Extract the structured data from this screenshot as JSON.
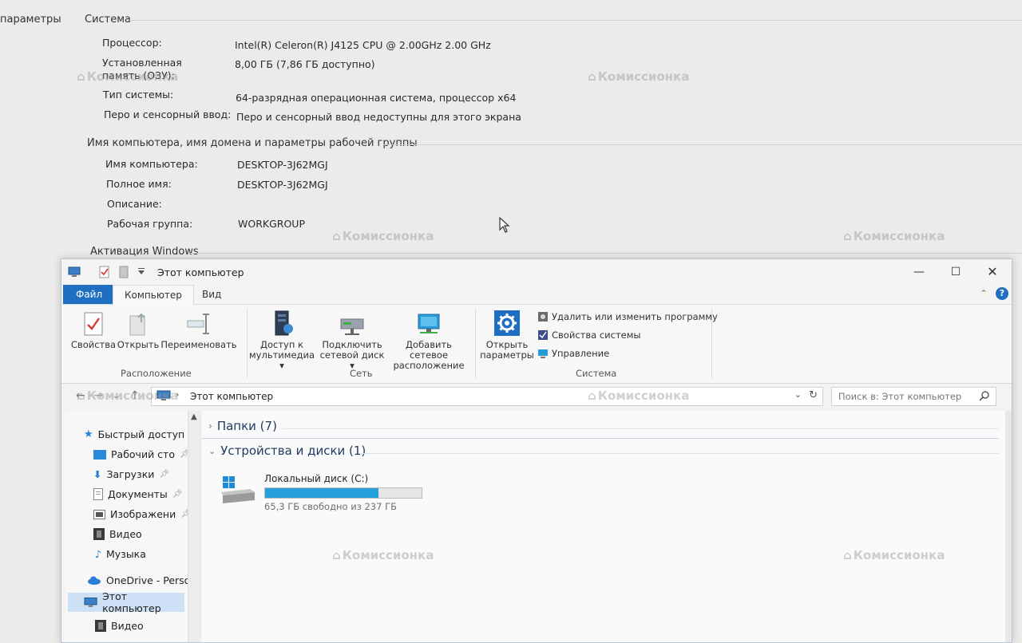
{
  "system_page": {
    "left_nav_label": "параметры",
    "section_system": "Система",
    "system_props": [
      {
        "label": "Процессор:",
        "value": "Intel(R) Celeron(R) J4125 CPU @ 2.00GHz   2.00 GHz"
      },
      {
        "label": "Установленная память (ОЗУ):",
        "value": "8,00 ГБ (7,86 ГБ доступно)"
      },
      {
        "label": "Тип системы:",
        "value": "64-разрядная операционная система, процессор x64"
      },
      {
        "label": "Перо и сенсорный ввод:",
        "value": "Перо и сенсорный ввод недоступны для этого экрана"
      }
    ],
    "section_computer": "Имя компьютера, имя домена и параметры рабочей группы",
    "computer_props": [
      {
        "label": "Имя компьютера:",
        "value": "DESKTOP-3J62MGJ"
      },
      {
        "label": "Полное имя:",
        "value": "DESKTOP-3J62MGJ"
      },
      {
        "label": "Описание:",
        "value": ""
      },
      {
        "label": "Рабочая группа:",
        "value": "WORKGROUP"
      }
    ],
    "section_activation": "Активация Windows"
  },
  "watermark_text": "Комиссионка",
  "explorer": {
    "title": "Этот компьютер",
    "window_buttons": {
      "minimize": "—",
      "maximize": "☐",
      "close": "✕"
    },
    "tabs": {
      "file": "Файл",
      "computer": "Компьютер",
      "view": "Вид"
    },
    "help": "?",
    "ribbon": {
      "properties": "Свойства",
      "open": "Открыть",
      "rename": "Переименовать",
      "group_location": "Расположение",
      "media_access_1": "Доступ к",
      "media_access_2": "мультимедиа ▾",
      "map_drive_1": "Подключить",
      "map_drive_2": "сетевой диск ▾",
      "add_location_1": "Добавить сетевое",
      "add_location_2": "расположение",
      "group_network": "Сеть",
      "open_settings_1": "Открыть",
      "open_settings_2": "параметры",
      "uninstall": "Удалить или изменить программу",
      "system_properties": "Свойства системы",
      "manage": "Управление",
      "group_system": "Система"
    },
    "address": {
      "path": "Этот компьютер",
      "search_placeholder": "Поиск в: Этот компьютер"
    },
    "nav": {
      "quick_access": "Быстрый доступ",
      "desktop": "Рабочий сто",
      "downloads": "Загрузки",
      "documents": "Документы",
      "pictures": "Изображени",
      "videos": "Видео",
      "music": "Музыка",
      "onedrive": "OneDrive - Persor",
      "this_pc": "Этот компьютер",
      "videos2": "Видео"
    },
    "content": {
      "folders_group": "Папки (7)",
      "devices_group": "Устройства и диски (1)",
      "drive_name": "Локальный диск (C:)",
      "drive_free": "65,3 ГБ свободно из 237 ГБ",
      "drive_used_fraction": 0.724
    }
  },
  "colors": {
    "accent": "#1f6fc0",
    "drive_fill": "#26a0da"
  }
}
